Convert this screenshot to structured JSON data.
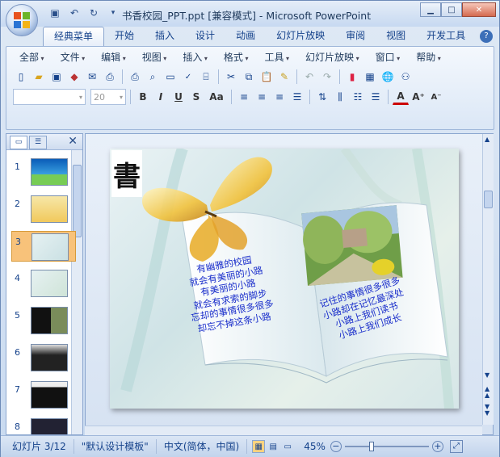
{
  "window": {
    "title": "书香校园_PPT.ppt [兼容模式] - Microsoft PowerPoint"
  },
  "ribbon_tabs": [
    "经典菜单",
    "开始",
    "插入",
    "设计",
    "动画",
    "幻灯片放映",
    "审阅",
    "视图",
    "开发工具"
  ],
  "classic_menu": [
    "全部",
    "文件",
    "编辑",
    "视图",
    "插入",
    "格式",
    "工具",
    "幻灯片放映",
    "窗口",
    "帮助"
  ],
  "font": {
    "name_placeholder": "",
    "size": "20"
  },
  "slides": [
    {
      "num": "1"
    },
    {
      "num": "2"
    },
    {
      "num": "3"
    },
    {
      "num": "4"
    },
    {
      "num": "5"
    },
    {
      "num": "6"
    },
    {
      "num": "7"
    },
    {
      "num": "8"
    }
  ],
  "slide_content": {
    "calligraphy": "書",
    "left_poem": [
      "有幽雅的校园",
      "就会有美丽的小路",
      "有美丽的小路",
      "就会有求索的脚步",
      "忘却的事情很多很多",
      "却忘不掉这条小路"
    ],
    "right_poem": [
      "记住的事情很多很多",
      "小路却在记忆最深处",
      "小路上我们读书",
      "小路上我们成长"
    ]
  },
  "status": {
    "slide_indicator": "幻灯片 3/12",
    "theme": "\"默认设计模板\"",
    "language": "中文(简体，中国)",
    "zoom": "45%"
  },
  "colors": {
    "accent": "#15428b",
    "poem_text": "#1a2ecb",
    "selected_thumb": "#f8c27a"
  }
}
